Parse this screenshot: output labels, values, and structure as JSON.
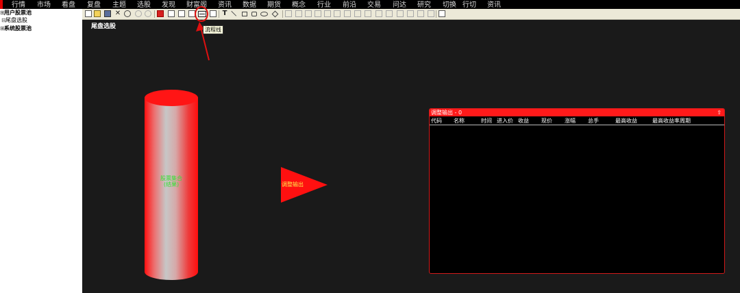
{
  "menu": [
    "行情",
    "市场",
    "看盘",
    "复盘",
    "主题",
    "选股",
    "发现",
    "财富阁",
    "资讯",
    "数据",
    "期货",
    "概念",
    "行业",
    "前沿",
    "交易",
    "问达",
    "研究",
    "切换",
    "行切",
    "资讯"
  ],
  "sidebar": {
    "items": [
      {
        "expander": "⊞",
        "label": "用户股票池"
      },
      {
        "expander": "⊟",
        "label": "尾盘选股"
      },
      {
        "expander": "⊞",
        "label": "系统股票池"
      }
    ]
  },
  "toolbar": {
    "tooltip": "流程线"
  },
  "canvas": {
    "title": "尾盘选股",
    "cylinder": {
      "line1": "股票集合",
      "line2": "(结果)"
    },
    "triangle": {
      "label": "调整输出"
    }
  },
  "panel": {
    "title": "调整输出 - 0",
    "up_icon": "⇧",
    "columns": [
      "代码",
      "名称",
      "时间",
      "进入价",
      "收益",
      "现价",
      "涨幅",
      "总手",
      "最高收益",
      "最高收益率周期"
    ]
  },
  "colors": {
    "accent": "#ff1a1a",
    "background": "#1a1a1a",
    "tooltip_bg": "#ffffe1",
    "label_green": "#33e233",
    "label_yellow": "#ffe84a"
  }
}
